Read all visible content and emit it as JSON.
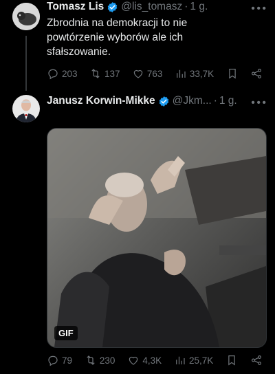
{
  "tweets": [
    {
      "name": "Tomasz Lis",
      "handle": "@lis_tomasz",
      "time": "1 g.",
      "text_lines": [
        "Zbrodnia na demokracji to nie",
        "powtórzenie wyborów ale ich",
        "sfałszowanie."
      ],
      "replies": "203",
      "retweets": "137",
      "likes": "763",
      "views": "33,7K"
    },
    {
      "name": "Janusz Korwin-Mikke",
      "handle": "@Jkm...",
      "time": "1 g.",
      "media_badge": "GIF",
      "replies": "79",
      "retweets": "230",
      "likes": "4,3K",
      "views": "25,7K"
    }
  ],
  "ui": {
    "dot": "·",
    "more_glyph": "• • •",
    "verified_color": "#1d9bf0",
    "muted_color": "#71767b"
  }
}
